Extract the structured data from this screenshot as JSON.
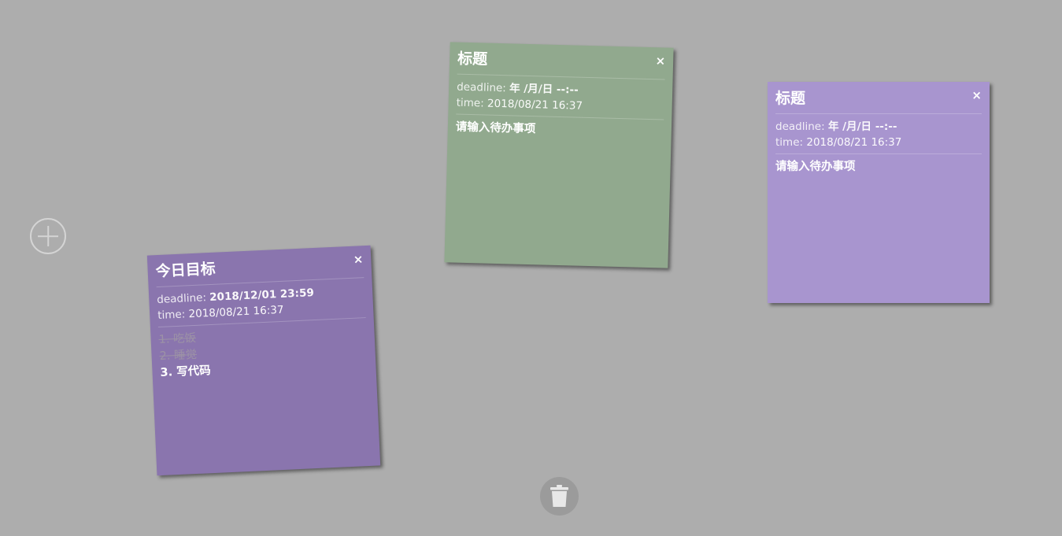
{
  "controls": {
    "add_icon": "plus-circle-icon",
    "trash_icon": "trash-icon"
  },
  "colors": {
    "background": "#adadad",
    "note_green": "#91a98e",
    "note_purple_light": "#a895cf",
    "note_purple_dark": "#8a75ae"
  },
  "notes": [
    {
      "title": "标题",
      "close": "×",
      "deadline_label": "deadline:",
      "deadline_value": "年 /月/日 --:--",
      "time_label": "time:",
      "time_value": "2018/08/21 16:37",
      "placeholder": "请输入待办事项",
      "color": "#91a98e"
    },
    {
      "title": "标题",
      "close": "×",
      "deadline_label": "deadline:",
      "deadline_value": "年 /月/日 --:--",
      "time_label": "time:",
      "time_value": "2018/08/21 16:37",
      "placeholder": "请输入待办事项",
      "color": "#a895cf"
    },
    {
      "title": "今日目标",
      "close": "×",
      "deadline_label": "deadline:",
      "deadline_value": "2018/12/01 23:59",
      "time_label": "time:",
      "time_value": "2018/08/21 16:37",
      "todos": [
        {
          "text": "1. 吃饭",
          "done": true
        },
        {
          "text": "2. 睡觉",
          "done": true
        },
        {
          "text": "3. 写代码",
          "done": false
        }
      ],
      "color": "#8a75ae"
    }
  ]
}
